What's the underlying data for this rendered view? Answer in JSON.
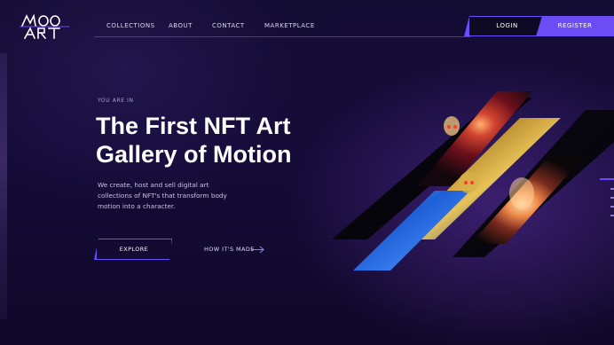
{
  "brand": {
    "name": "MOO ART",
    "logo_icon": "moo-art-logo"
  },
  "nav": {
    "items": [
      {
        "label": "COLLECTIONS"
      },
      {
        "label": "ABOUT"
      },
      {
        "label": "CONTACT"
      },
      {
        "label": "MARKETPLACE"
      }
    ]
  },
  "auth": {
    "login_label": "LOGIN",
    "register_label": "REGISTER"
  },
  "hero": {
    "eyebrow": "YOU ARE IN",
    "title_line1": "The First NFT Art",
    "title_line2": "Gallery of Motion",
    "description_line1": "We create, host and sell digital art",
    "description_line2": "collections of NFT's that transform body",
    "description_line3": "motion into a character.",
    "explore_label": "EXPLORE",
    "how_label": "HOW IT'S MADE",
    "how_icon": "arrow-right-icon"
  },
  "colors": {
    "accent": "#6b4cf5",
    "background": "#130c33",
    "text": "#ffffff"
  }
}
